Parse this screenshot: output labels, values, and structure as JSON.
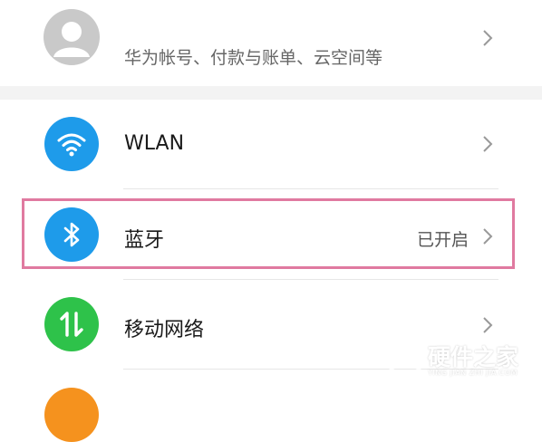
{
  "account": {
    "subtitle": "华为帐号、付款与账单、云空间等",
    "avatar_color": "#c9c9c9"
  },
  "settings": [
    {
      "key": "wlan",
      "title": "WLAN",
      "status": "",
      "icon": "wifi-icon",
      "color": "#1e9bea"
    },
    {
      "key": "bluetooth",
      "title": "蓝牙",
      "status": "已开启",
      "icon": "bluetooth-icon",
      "color": "#1e9bea",
      "highlighted": true
    },
    {
      "key": "mobile-network",
      "title": "移动网络",
      "status": "",
      "icon": "mobile-data-icon",
      "color": "#2ec24a"
    },
    {
      "key": "partial",
      "color": "#f5921e"
    }
  ],
  "watermark": {
    "name": "硬件之家",
    "url": "YING JIAN ZHI JIA.COM"
  },
  "highlight_color": "#e07aa0"
}
